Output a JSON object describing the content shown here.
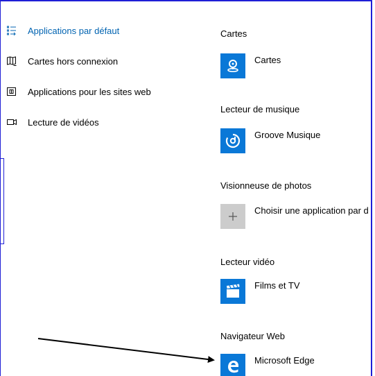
{
  "sidebar": {
    "items": [
      {
        "label": "Applications par défaut",
        "icon": "default-apps-icon",
        "active": true
      },
      {
        "label": "Cartes hors connexion",
        "icon": "offline-maps-icon",
        "active": false
      },
      {
        "label": "Applications pour les sites web",
        "icon": "apps-for-websites-icon",
        "active": false
      },
      {
        "label": "Lecture de vidéos",
        "icon": "video-playback-icon",
        "active": false
      }
    ]
  },
  "main": {
    "sections": [
      {
        "title": "Cartes",
        "app": "Cartes",
        "icon": "maps-icon"
      },
      {
        "title": "Lecteur de musique",
        "app": "Groove Musique",
        "icon": "groove-music-icon"
      },
      {
        "title": "Visionneuse de photos",
        "app": "Choisir une application par d",
        "icon": "plus-icon"
      },
      {
        "title": "Lecteur vidéo",
        "app": "Films et TV",
        "icon": "films-tv-icon"
      },
      {
        "title": "Navigateur Web",
        "app": "Microsoft Edge",
        "icon": "edge-icon"
      }
    ]
  },
  "colors": {
    "accent": "#0063b1",
    "tile_blue": "#0a78d7",
    "tile_gray": "#cccccc",
    "annotation": "#1f1fd6"
  }
}
